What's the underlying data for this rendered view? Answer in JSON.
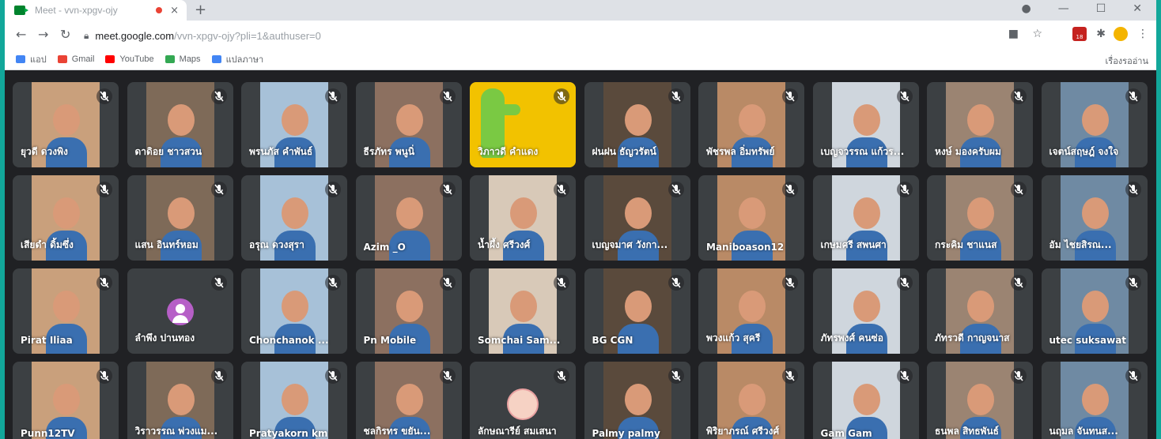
{
  "browser": {
    "tab_title": "Meet - vvn-xpgv-ojy",
    "tab_close": "×",
    "new_tab": "+",
    "url_host": "meet.google.com",
    "url_path": "/vvn-xpgv-ojy?pli=1&authuser=0",
    "bookmarks": [
      {
        "label": "แอป",
        "color": "#4285f4"
      },
      {
        "label": "Gmail",
        "color": "#ea4335"
      },
      {
        "label": "YouTube",
        "color": "#ff0000"
      },
      {
        "label": "Maps",
        "color": "#34a853"
      },
      {
        "label": "แปลภาษา",
        "color": "#4285f4"
      }
    ],
    "reading_list": "เรื่องรออ่าน",
    "ext_badge": "18"
  },
  "participants": [
    {
      "name": "ยุวดี ดวงพิง",
      "video": true
    },
    {
      "name": "ดาดิอย ชาวสวน",
      "video": true
    },
    {
      "name": "พรนภัส คำพันธ์",
      "video": true
    },
    {
      "name": "ธีรภัทร พนูนิ่",
      "video": true
    },
    {
      "name": "วิภาวดี คำแดง",
      "video": true,
      "sticker": true
    },
    {
      "name": "ฝนฝน ธัญวรัตน์",
      "video": true
    },
    {
      "name": "พัชรพล อิ่มทรัพย์",
      "video": true
    },
    {
      "name": "เบญจวรรณ แก้วร...",
      "video": true
    },
    {
      "name": "หงษ์ มองครับผม",
      "video": true
    },
    {
      "name": "เจตน์สฤษฎ์ จงใจ",
      "video": true
    },
    {
      "name": "เสียดำ ดิ้มซึ่ง",
      "video": true
    },
    {
      "name": "แสน อินทร์หอม",
      "video": true
    },
    {
      "name": "อรุณ ดวงสุรา",
      "video": true
    },
    {
      "name": "Azim _O",
      "video": true
    },
    {
      "name": "น้ำผึ้ง ศรีวงศ์",
      "video": true
    },
    {
      "name": "เบญจมาศ วังกา...",
      "video": true
    },
    {
      "name": "Maniboason12",
      "video": true
    },
    {
      "name": "เกษมศรี สพนศา",
      "video": true
    },
    {
      "name": "กระคิม ชาแนส",
      "video": true
    },
    {
      "name": "อัม ไชยสิรณ...",
      "video": true
    },
    {
      "name": "Pirat Iliaa",
      "video": true
    },
    {
      "name": "ลำพึง ปานทอง",
      "video": false
    },
    {
      "name": "Chonchanok ...",
      "video": true
    },
    {
      "name": "Pn Mobile",
      "video": true
    },
    {
      "name": "Somchai Sam...",
      "video": true
    },
    {
      "name": "BG CGN",
      "video": true
    },
    {
      "name": "พวงแก้ว สุครี",
      "video": true
    },
    {
      "name": "ภัทรพงศ์ คนซ่อ",
      "video": true
    },
    {
      "name": "ภัทรวดี กาญจนาส",
      "video": true
    },
    {
      "name": "utec suksawat",
      "video": true
    },
    {
      "name": "Punn12TV",
      "video": true
    },
    {
      "name": "วิราวรรณ พ่วงแม...",
      "video": true
    },
    {
      "name": "Pratyakorn km",
      "video": true
    },
    {
      "name": "ชลกิรทร ขยัน...",
      "video": true
    },
    {
      "name": "ลักษณารีย์ สมเสนา",
      "video": false,
      "photo": true
    },
    {
      "name": "Palmy palmy",
      "video": true
    },
    {
      "name": "พิริยาภรณ์ ศรีวงศ์",
      "video": true
    },
    {
      "name": "Gam Gam",
      "video": true
    },
    {
      "name": "ธนพล สิทธพันธ์",
      "video": true
    },
    {
      "name": "นฤมล จันทนส...",
      "video": true
    }
  ],
  "colors": {
    "page_border": "#12a79a",
    "meet_bg": "#202124",
    "tile_bg": "#3c4043"
  },
  "bg_tones": [
    "#c9a07c",
    "#7e6a58",
    "#a7c1d8",
    "#8c7060",
    "#d8c9b8",
    "#5a4a3c",
    "#b98a66",
    "#cfd6dd",
    "#9b8472",
    "#6f8aa3"
  ]
}
